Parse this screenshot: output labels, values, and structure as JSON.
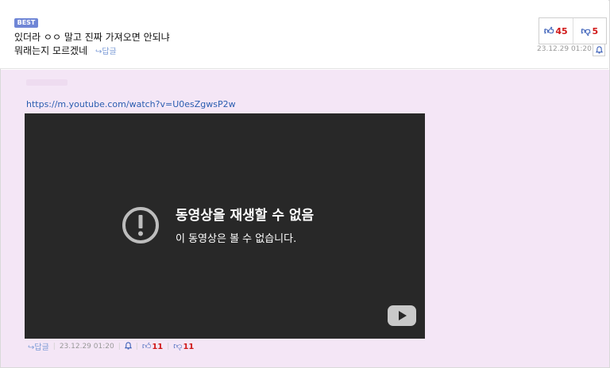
{
  "top_comment": {
    "badge": "BEST",
    "line1": "있더라 ㅇㅇ 말고 진짜 가져오면 안되냐",
    "line2": "뭐래는지 모르겠네",
    "reply_link": "↪답글",
    "upvotes": "45",
    "downvotes": "5",
    "timestamp": "23.12.29 01:20"
  },
  "reply": {
    "url": "https://m.youtube.com/watch?v=U0esZgwsP2w",
    "video": {
      "error_title": "동영상을 재생할 수 없음",
      "error_subtitle": "이 동영상은 볼 수 없습니다."
    },
    "reply_link": "↪답글",
    "timestamp": "23.12.29 01:20",
    "upvotes": "11",
    "downvotes": "11"
  },
  "icons": {
    "thumb_up": "thumbs-up-icon",
    "thumb_down": "thumbs-down-icon",
    "bell": "bell-icon",
    "error": "exclamation-circle-icon",
    "youtube": "youtube-logo-icon"
  },
  "colors": {
    "accent": "#3a5fb8",
    "count_red": "#d01818",
    "reply_bg": "#f4e6f6",
    "badge_bg": "#6f86d6",
    "video_bg": "#282828"
  }
}
